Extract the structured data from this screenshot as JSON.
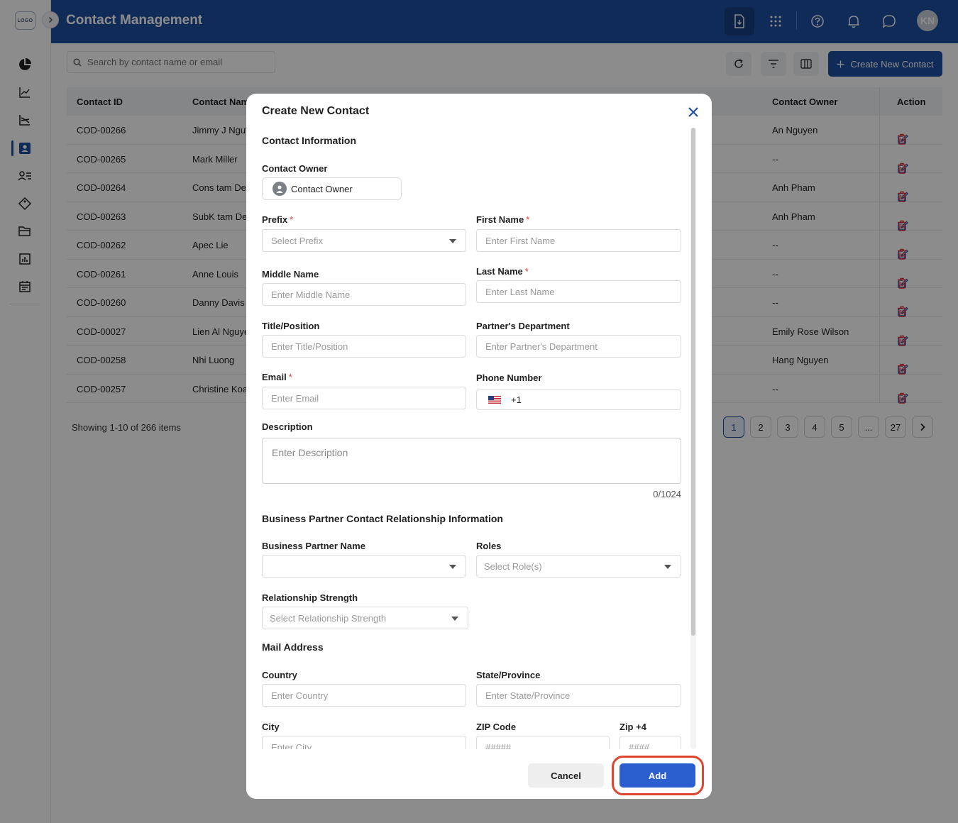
{
  "app": {
    "logo_text": "LOGO",
    "title": "Contact Management",
    "avatar_initials": "KN",
    "accent": "#1f4fa3"
  },
  "sidebar": {
    "items": [
      {
        "name": "dashboard",
        "icon": "pie-chart-icon"
      },
      {
        "name": "analytics",
        "icon": "line-chart-icon"
      },
      {
        "name": "pipeline",
        "icon": "trend-chart-icon"
      },
      {
        "name": "contacts",
        "icon": "contact-card-icon",
        "active": true
      },
      {
        "name": "leads",
        "icon": "user-list-icon"
      },
      {
        "name": "deals",
        "icon": "tag-icon"
      },
      {
        "name": "files",
        "icon": "folder-icon"
      },
      {
        "name": "reports",
        "icon": "bar-report-icon"
      },
      {
        "name": "calendar",
        "icon": "calendar-icon"
      }
    ]
  },
  "toolbar": {
    "search_placeholder": "Search by contact name or email",
    "create_label": "Create New Contact"
  },
  "table": {
    "headers": {
      "id": "Contact ID",
      "name": "Contact Name",
      "owner": "Contact Owner",
      "action": "Action"
    },
    "rows": [
      {
        "id": "COD-00266",
        "name": "Jimmy J Nguyen",
        "owner": "An Nguyen"
      },
      {
        "id": "COD-00265",
        "name": "Mark Miller",
        "owner": "--"
      },
      {
        "id": "COD-00264",
        "name": "Cons tam Dem",
        "owner": "Anh Pham"
      },
      {
        "id": "COD-00263",
        "name": "SubK tam Dem",
        "owner": "Anh Pham"
      },
      {
        "id": "COD-00262",
        "name": "Apec Lie",
        "owner": "--"
      },
      {
        "id": "COD-00261",
        "name": "Anne Louis",
        "owner": "--"
      },
      {
        "id": "COD-00260",
        "name": "Danny Davis",
        "owner": "--"
      },
      {
        "id": "COD-00027",
        "name": "Lien Al Nguyen",
        "owner": "Emily Rose Wilson"
      },
      {
        "id": "COD-00258",
        "name": "Nhi Luong",
        "owner": "Hang Nguyen"
      },
      {
        "id": "COD-00257",
        "name": "Christine Koala",
        "owner": "--"
      }
    ],
    "showing": "Showing 1-10 of 266 items",
    "pages": [
      "1",
      "2",
      "3",
      "4",
      "5",
      "...",
      "27"
    ],
    "current_page": "1"
  },
  "modal": {
    "title": "Create New Contact",
    "contact_info_title": "Contact Information",
    "contact_owner_label": "Contact Owner",
    "contact_owner_value": "Contact Owner",
    "prefix_label": "Prefix",
    "prefix_placeholder": "Select Prefix",
    "first_name_label": "First Name",
    "first_name_placeholder": "Enter First Name",
    "middle_name_label": "Middle Name",
    "middle_name_placeholder": "Enter Middle Name",
    "last_name_label": "Last Name",
    "last_name_placeholder": "Enter Last Name",
    "title_label": "Title/Position",
    "title_placeholder": "Enter Title/Position",
    "dept_label": "Partner's Department",
    "dept_placeholder": "Enter Partner's Department",
    "email_label": "Email",
    "email_placeholder": "Enter Email",
    "phone_label": "Phone Number",
    "phone_code": "+1",
    "description_label": "Description",
    "description_placeholder": "Enter Description",
    "description_counter": "0/1024",
    "bp_title": "Business Partner Contact Relationship Information",
    "bp_name_label": "Business Partner Name",
    "roles_label": "Roles",
    "roles_placeholder": "Select Role(s)",
    "strength_label": "Relationship Strength",
    "strength_placeholder": "Select Relationship Strength",
    "mail_title": "Mail Address",
    "country_label": "Country",
    "country_placeholder": "Enter Country",
    "state_label": "State/Province",
    "state_placeholder": "Enter State/Province",
    "city_label": "City",
    "city_placeholder": "Enter City",
    "zip_label": "ZIP Code",
    "zip_placeholder": "#####",
    "zip4_label": "Zip +4",
    "zip4_placeholder": "####",
    "required_mark": "*",
    "cancel_label": "Cancel",
    "add_label": "Add",
    "highlight_color": "#e0452f"
  }
}
